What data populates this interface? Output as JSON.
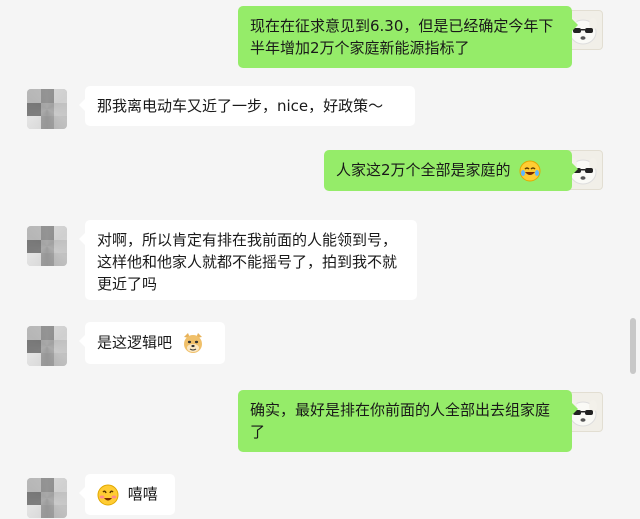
{
  "messages": [
    {
      "from": "me",
      "text": "现在在征求意见到6.30，但是已经确定今年下半年增加2万个家庭新能源指标了",
      "avatar_icon": "cartoon-dog-with-sunglasses"
    },
    {
      "from": "other",
      "text": "那我离电动车又近了一步，nice，好政策～",
      "avatar_icon": "pixelated-avatar"
    },
    {
      "from": "me",
      "text": "人家这2万个全部是家庭的",
      "emoji": "laughing-tears-emoji",
      "avatar_icon": "cartoon-dog-with-sunglasses"
    },
    {
      "from": "other",
      "text": "对啊，所以肯定有排在我前面的人能领到号，这样他和他家人就都不能摇号了，拍到我不就更近了吗",
      "avatar_icon": "pixelated-avatar"
    },
    {
      "from": "other",
      "text": "是这逻辑吧",
      "emoji": "doge-emoji",
      "avatar_icon": "pixelated-avatar"
    },
    {
      "from": "me",
      "text": "确实，最好是排在你前面的人全部出去组家庭了",
      "avatar_icon": "cartoon-dog-with-sunglasses"
    },
    {
      "from": "other",
      "text": "嘻嘻",
      "emoji": "grinning-blush-emoji",
      "emoji_position": "before",
      "avatar_icon": "pixelated-avatar"
    }
  ],
  "colors": {
    "background": "#f5f5f5",
    "my_bubble": "#95ec69",
    "other_bubble": "#ffffff"
  }
}
